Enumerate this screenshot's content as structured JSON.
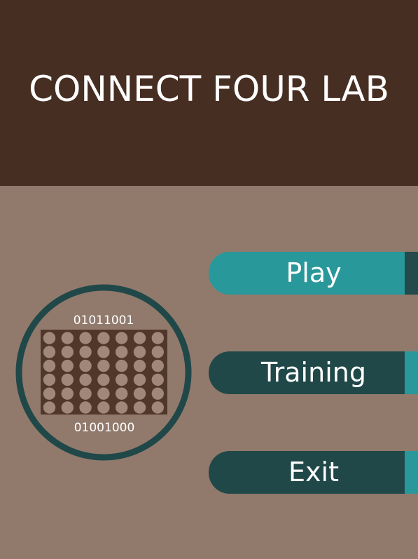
{
  "app": {
    "title": "CONNECT FOUR LAB"
  },
  "logo": {
    "top_binary": "01011001",
    "bottom_binary": "01001000",
    "grid_rows": 6,
    "grid_cols": 7
  },
  "menu": {
    "play_label": "Play",
    "training_label": "Training",
    "exit_label": "Exit"
  },
  "colors": {
    "header_bg": "#472e22",
    "page_bg": "#917a6c",
    "teal": "#28989a",
    "dark_teal": "#214849",
    "board": "#50372a",
    "disc": "#a08779"
  }
}
